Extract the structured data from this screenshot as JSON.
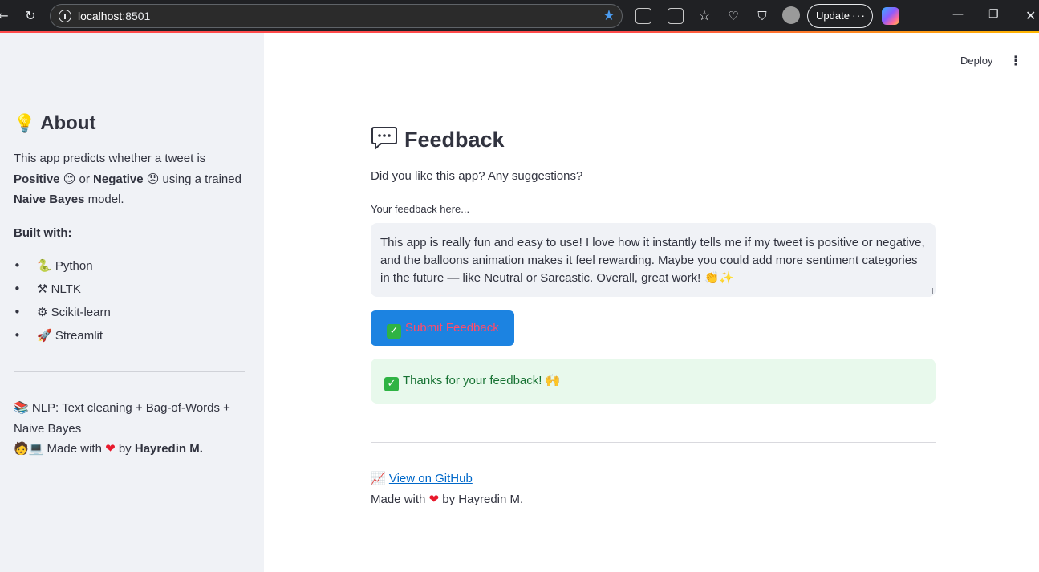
{
  "browser": {
    "url_host": "localhost",
    "url_port": ":8501",
    "update_label": "Update",
    "more_label": "···"
  },
  "sidebar": {
    "title": "About",
    "title_icon": "lightbulb-icon",
    "desc_pre": "This app predicts whether a tweet is",
    "positive": "Positive",
    "or": "or",
    "negative": "Negative",
    "using": "using a trained",
    "model": "Naive Bayes",
    "model_suffix": "model.",
    "built_with": "Built with:",
    "tools": [
      {
        "icon": "🐍",
        "label": "Python"
      },
      {
        "icon": "⚒",
        "label": "NLTK"
      },
      {
        "icon": "⚙",
        "label": "Scikit-learn"
      },
      {
        "icon": "🚀",
        "label": "Streamlit"
      }
    ],
    "nlp_line": "NLP: Text cleaning + Bag-of-Words +",
    "nlp_line2": "Naive Bayes",
    "made_with": "Made with",
    "by": "by",
    "author": "Hayredin M."
  },
  "header": {
    "deploy_label": "Deploy"
  },
  "main": {
    "title": "Feedback",
    "prompt": "Did you like this app? Any suggestions?",
    "feedback_label": "Your feedback here...",
    "feedback_value": "This app is really fun and easy to use! I love how it instantly tells me if my tweet is positive or negative, and the balloons animation makes it feel rewarding. Maybe you could add more sentiment categories in the future — like Neutral or Sarcastic. Overall, great work! 👏✨",
    "submit_label": "Submit Feedback",
    "success_text": "Thanks for your feedback! 🙌",
    "github_link": "View on GitHub",
    "made_with": "Made with",
    "by_author": "by Hayredin M."
  },
  "colors": {
    "accent": "#1c83e1",
    "sidebar_bg": "#f0f2f6",
    "success_bg": "#e8f9ec",
    "success_text": "#177233",
    "link": "#0068c9"
  }
}
